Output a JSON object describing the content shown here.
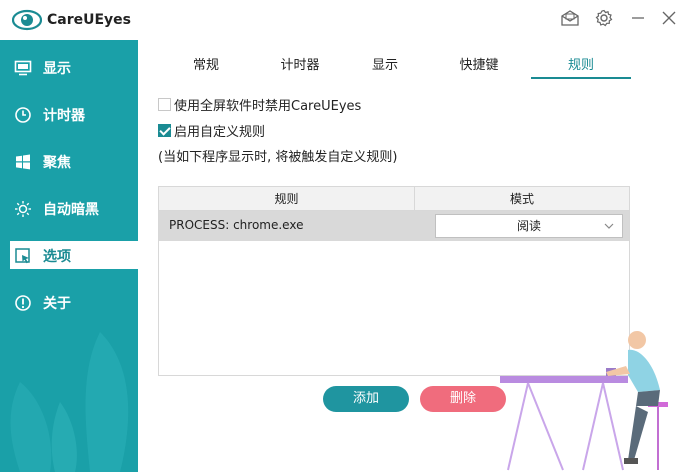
{
  "app": {
    "title": "CareUEyes"
  },
  "titlebar": {
    "icons": [
      "mail-icon",
      "gear-icon",
      "minimize-icon",
      "close-icon"
    ]
  },
  "sidebar": {
    "items": [
      {
        "label": "显示",
        "icon": "monitor-icon"
      },
      {
        "label": "计时器",
        "icon": "clock-icon"
      },
      {
        "label": "聚焦",
        "icon": "windows-icon"
      },
      {
        "label": "自动暗黑",
        "icon": "sun-icon"
      },
      {
        "label": "选项",
        "icon": "options-icon",
        "active": true
      },
      {
        "label": "关于",
        "icon": "info-icon"
      }
    ]
  },
  "tabs": [
    {
      "label": "常规"
    },
    {
      "label": "计时器"
    },
    {
      "label": "显示"
    },
    {
      "label": "快捷键"
    },
    {
      "label": "规则",
      "active": true
    }
  ],
  "options": {
    "fullscreen_label": "使用全屏软件时禁用CareUEyes",
    "fullscreen_checked": false,
    "custom_rules_label": "启用自定义规则",
    "custom_rules_checked": true,
    "note": "(当如下程序显示时, 将被触发自定义规则)"
  },
  "table": {
    "headers": [
      "规则",
      "模式"
    ],
    "rows": [
      {
        "rule": "PROCESS: chrome.exe",
        "mode": "阅读"
      }
    ]
  },
  "buttons": {
    "add": "添加",
    "delete": "删除"
  },
  "colors": {
    "accent": "#1a8b93",
    "sidebar": "#1aa0a8",
    "delete": "#f06c7d"
  }
}
